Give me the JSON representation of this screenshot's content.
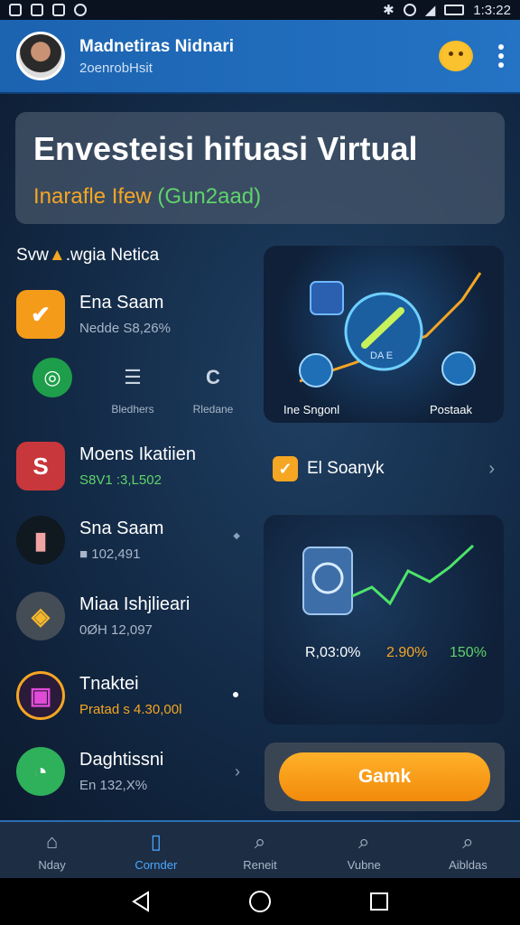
{
  "status_bar": {
    "time": "1:3:22"
  },
  "header": {
    "name": "Madnetiras Nidnari",
    "subtitle": "2oenrobHsit"
  },
  "banner": {
    "title": "Envesteisi hifuasi Virtual",
    "sub_orange": "Inarafle Ifew",
    "sub_green": "(Gun2aad)"
  },
  "section": {
    "prefix": "Svw",
    "suffix": ".wgia Netica"
  },
  "items": [
    {
      "title": "Ena Saam",
      "sub": "Nedde S8,26% "
    },
    {
      "title": "Moens Ikatiien",
      "sub": "S8V1 :3,L502"
    },
    {
      "title": "Sna Saam",
      "sub": "■ 102,491"
    },
    {
      "title": "Miaa Ishjlieari",
      "sub": "0ØH 12,097"
    },
    {
      "title": "Tnaktei",
      "sub": "Pratad s 4.30,00l"
    },
    {
      "title": "Daghtissni",
      "sub": "En 132,X%"
    }
  ],
  "quick": [
    {
      "label": ""
    },
    {
      "label": "Bledhers"
    },
    {
      "label": "Rledane"
    }
  ],
  "card_a": {
    "center_label": "DA  E",
    "left_label": "Ine Sngonl",
    "right_label": "Postaak"
  },
  "promo": {
    "label": "El Soanyk"
  },
  "card_b": {
    "stat1": "R,03:0%",
    "stat2": "2.90%",
    "stat3": "150%"
  },
  "cta": {
    "label": "Gamk"
  },
  "nav": [
    {
      "label": "Nday"
    },
    {
      "label": "Cornder"
    },
    {
      "label": "Reneit"
    },
    {
      "label": "Vubne"
    },
    {
      "label": "Aibldas"
    }
  ],
  "colors": {
    "accent": "#f5a623",
    "green": "#5fd36b",
    "header": "#1c63b0",
    "active": "#4aa8ff"
  }
}
